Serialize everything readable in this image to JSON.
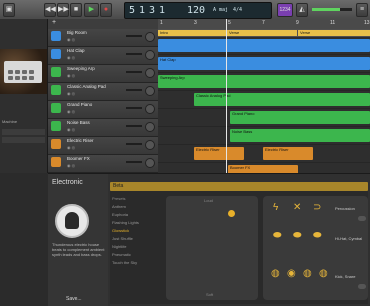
{
  "toolbar": {
    "lcd": {
      "bars": "5",
      "beat": "1",
      "div": "3",
      "tick": "1",
      "bpm": "120",
      "key": "A maj",
      "sig": "4/4",
      "bar_lbl": "BAR",
      "beat_lbl": "BEAT",
      "tempo_lbl": "TEMPO"
    },
    "badge": "1234"
  },
  "ruler": {
    "marks": [
      "1",
      "3",
      "5",
      "7",
      "9",
      "11",
      "13"
    ],
    "sections": [
      "Intro",
      "Verse",
      "Verse"
    ]
  },
  "tracks": [
    {
      "name": "Big Room",
      "color": "#3a8de0"
    },
    {
      "name": "Hat Clap",
      "color": "#3a8de0"
    },
    {
      "name": "Sweeping Arp",
      "color": "#3cb64d"
    },
    {
      "name": "Classic Analog Pad",
      "color": "#3cb64d"
    },
    {
      "name": "Grand Piano",
      "color": "#3cb64d"
    },
    {
      "name": "Noise Bass",
      "color": "#3cb64d"
    },
    {
      "name": "Electric Riser",
      "color": "#d98a2b"
    },
    {
      "name": "Boomer FX",
      "color": "#d98a2b"
    }
  ],
  "regions": {
    "hat_clap": "Hat Clap",
    "sweeping_arp": "Sweeping Arp",
    "pad": "Classic Analog Pad",
    "piano": "Grand Piano",
    "noise_bass": "Noise Bass",
    "riser1": "Electric Riser",
    "riser2": "Electric Riser",
    "boomer": "Boomer FX"
  },
  "library": {
    "items": [
      "Machine"
    ]
  },
  "editor": {
    "title": "Electronic",
    "header_label": "Beta",
    "description": "Thunderous electric house beats to complement ambient synth leads and bass drops.",
    "presets_header": "Presets",
    "presets": [
      "Anthem",
      "Euphoria",
      "Flashing Lights",
      "Glowstick",
      "Just Shuffle",
      "Nightlife",
      "Pneumatic",
      "Touch the Sky"
    ],
    "selected_preset": "Glowstick",
    "xy_top": "Loud",
    "xy_bottom": "Soft",
    "kit_labels": [
      "Percussion",
      "Hi-Hat, Cymbal",
      "Kick, Snare"
    ],
    "save_button": "Save..."
  },
  "colors": {
    "accent": "#e8b02a",
    "blue": "#3a8de0",
    "green": "#3cb64d",
    "orange": "#d98a2b"
  }
}
